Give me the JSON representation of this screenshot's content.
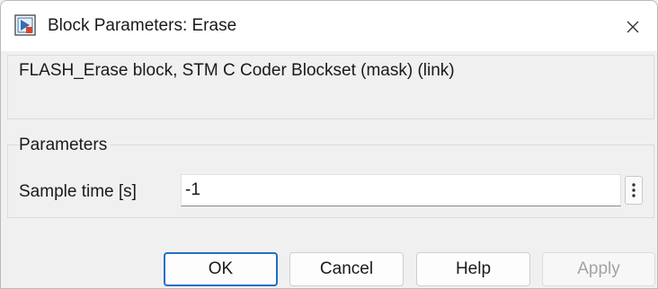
{
  "window": {
    "title": "Block Parameters: Erase"
  },
  "description": {
    "text": "FLASH_Erase block, STM C Coder Blockset (mask) (link)"
  },
  "parameters": {
    "header": "Parameters",
    "sample_time": {
      "label": "Sample time [s]",
      "value": "-1"
    }
  },
  "buttons": {
    "ok": "OK",
    "cancel": "Cancel",
    "help": "Help",
    "apply": "Apply"
  },
  "icons": {
    "app": "simulink-block-icon",
    "close": "close-icon",
    "more": "vertical-ellipsis-icon"
  },
  "colors": {
    "accent": "#1f6fc8",
    "disabled_text": "#a3a3a3"
  }
}
